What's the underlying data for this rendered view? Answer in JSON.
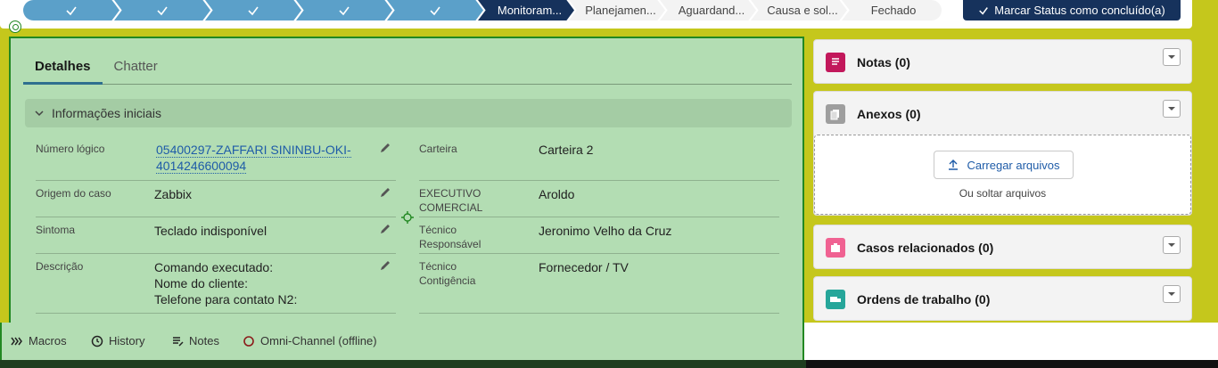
{
  "path": {
    "steps": [
      {
        "label": "",
        "state": "complete"
      },
      {
        "label": "",
        "state": "complete"
      },
      {
        "label": "",
        "state": "complete"
      },
      {
        "label": "",
        "state": "complete"
      },
      {
        "label": "",
        "state": "complete"
      },
      {
        "label": "Monitoram...",
        "state": "current"
      },
      {
        "label": "Planejamen...",
        "state": "incomplete"
      },
      {
        "label": "Aguardand...",
        "state": "incomplete"
      },
      {
        "label": "Causa e sol...",
        "state": "incomplete"
      },
      {
        "label": "Fechado",
        "state": "incomplete"
      }
    ],
    "mark_complete_label": "Marcar Status como concluído(a)"
  },
  "tabs": {
    "details": "Detalhes",
    "chatter": "Chatter"
  },
  "section": {
    "title": "Informações iniciais"
  },
  "fields": {
    "numero_logico": {
      "label": "Número lógico",
      "value_line1": "05400297-ZAFFARI SININBU-OKI-",
      "value_line2": "4014246600094"
    },
    "origem": {
      "label": "Origem do caso",
      "value": "Zabbix"
    },
    "sintoma": {
      "label": "Sintoma",
      "value": "Teclado indisponível"
    },
    "descricao": {
      "label": "Descrição",
      "line1": "Comando executado:",
      "line2": "Nome do cliente:",
      "line3": "Telefone para contato N2:"
    },
    "carteira": {
      "label": "Carteira",
      "value": "Carteira 2"
    },
    "executivo": {
      "label_line1": "EXECUTIVO",
      "label_line2": "COMERCIAL",
      "value": "Aroldo"
    },
    "tecnico_resp": {
      "label_line1": "Técnico",
      "label_line2": "Responsável",
      "value": "Jeronimo Velho da Cruz"
    },
    "tecnico_cont": {
      "label_line1": "Técnico",
      "label_line2": "Contigência",
      "value": "Fornecedor / TV"
    }
  },
  "utility_bar": {
    "macros": "Macros",
    "history": "History",
    "notes": "Notes",
    "omni": "Omni-Channel (offline)"
  },
  "right_panel": {
    "notas": "Notas (0)",
    "anexos": "Anexos (0)",
    "upload_button": "Carregar arquivos",
    "drop_text": "Ou soltar arquivos",
    "casos": "Casos relacionados (0)",
    "ordens": "Ordens de trabalho (0)"
  },
  "colors": {
    "complete": "#5ba0c9",
    "current": "#16325c",
    "highlight": "#b3ddb3",
    "highlight_border": "#228822",
    "notas_icon": "#c2185b",
    "anexos_icon": "#9e9e9e",
    "casos_icon": "#f06292",
    "ordens_icon": "#26a69a"
  }
}
